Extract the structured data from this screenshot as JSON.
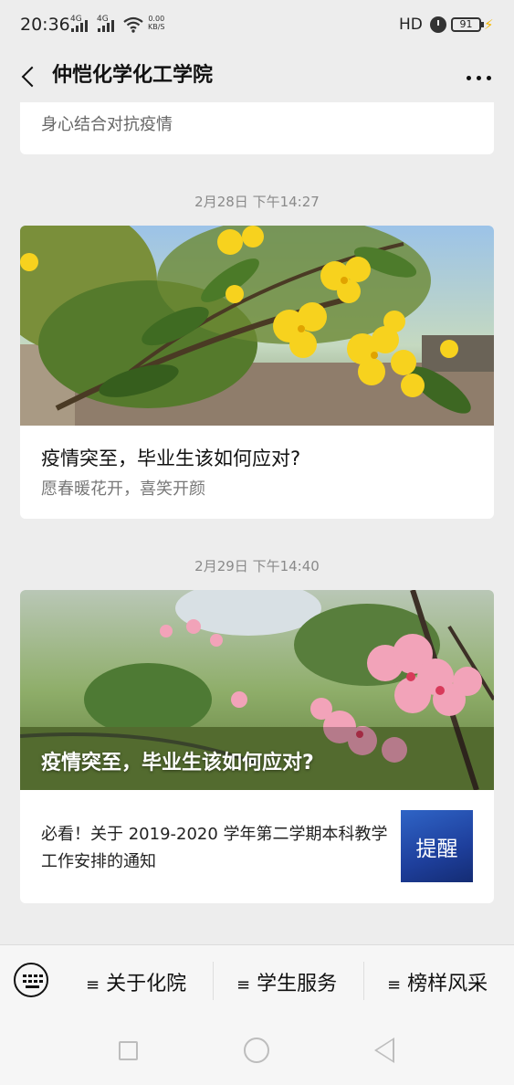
{
  "status_bar": {
    "time": "20:36",
    "signal_1": "4G",
    "signal_2": "4G",
    "net_speed_value": "0.00",
    "net_speed_unit": "KB/S",
    "hd": "HD",
    "battery": "91"
  },
  "nav": {
    "title": "仲恺化学化工学院"
  },
  "feed": {
    "top_card_subtitle": "身心结合对抗疫情",
    "messages": [
      {
        "timestamp": "2月28日 下午14:27",
        "title": "疫情突至，毕业生该如何应对?",
        "subtitle": "愿春暖花开，喜笑开颜"
      },
      {
        "timestamp": "2月29日 下午14:40",
        "cover_title": "疫情突至，毕业生该如何应对?",
        "related_title": "必看！关于 2019-2020 学年第二学期本科教学工作安排的通知",
        "related_thumb_text": "提醒"
      }
    ]
  },
  "bottom_menu": {
    "items": [
      {
        "label": "关于化院"
      },
      {
        "label": "学生服务"
      },
      {
        "label": "榜样风采"
      }
    ]
  },
  "colors": {
    "background": "#ededed",
    "card": "#ffffff",
    "timestamp": "#8a8a8a",
    "thumb_blue": "#2f64c6"
  }
}
